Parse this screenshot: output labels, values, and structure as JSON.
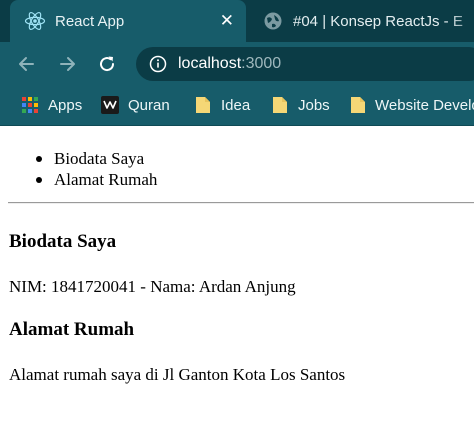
{
  "browser": {
    "tabs": [
      {
        "title": "React App",
        "icon": "react-icon",
        "close": "✕"
      },
      {
        "title": "#04 | Konsep ReactJs - E",
        "icon": "globe-icon",
        "close": "✕"
      }
    ],
    "address": {
      "host": "localhost",
      "port": ":3000"
    },
    "bookmarks": [
      {
        "label": "Apps",
        "icon": "apps-grid-icon"
      },
      {
        "label": "Quran",
        "icon": "quran-icon"
      },
      {
        "label": "Idea",
        "icon": "folder-icon"
      },
      {
        "label": "Jobs",
        "icon": "folder-icon"
      },
      {
        "label": "Website Development",
        "icon": "folder-icon"
      }
    ],
    "colors": {
      "tabbar": "#0b3c46",
      "toolbar": "#175c6a",
      "folder": "#f5d776"
    }
  },
  "page": {
    "nav": [
      "Biodata Saya",
      "Alamat Rumah"
    ],
    "sections": [
      {
        "heading": "Biodata Saya",
        "text": "NIM: 1841720041 - Nama: Ardan Anjung"
      },
      {
        "heading": "Alamat Rumah",
        "text": "Alamat rumah saya di Jl Ganton Kota Los Santos"
      }
    ]
  }
}
